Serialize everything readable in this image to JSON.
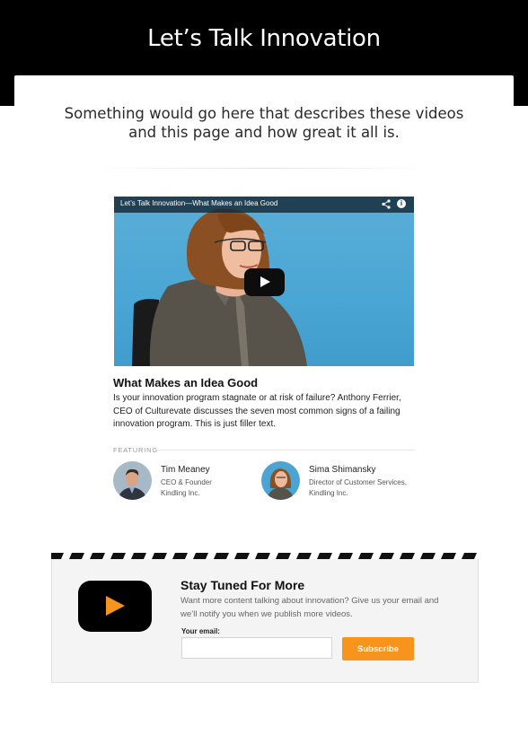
{
  "page": {
    "title": "Let’s Talk Innovation",
    "intro": "Something would go here that describes these videos and this page and how great it all is."
  },
  "video": {
    "player_title": "Let’s Talk Innovation—What Makes an Idea Good",
    "share_icon": "share-icon",
    "info_icon": "info-icon",
    "info_glyph": "i",
    "title": "What Makes an Idea Good",
    "description": "Is your innovation program stagnate or at risk of failure? Anthony Ferrier, CEO of Culturevate discusses the seven most common signs of a failing innovation program. This is just filler text."
  },
  "featuring": {
    "label": "FEATURING",
    "people": [
      {
        "name": "Tim Meaney",
        "role_line1": "CEO & Founder",
        "role_line2": "Kindling Inc."
      },
      {
        "name": "Sima Shimansky",
        "role_line1": "Director of Customer Services,",
        "role_line2": "Kindling Inc."
      }
    ]
  },
  "subscribe": {
    "title": "Stay Tuned For More",
    "description": "Want more content talking about innovation? Give us your email and we’ll notify you when we publish more videos.",
    "email_label": "Your email:",
    "email_value": "",
    "email_placeholder": "",
    "button_label": "Subscribe"
  },
  "colors": {
    "header_bg": "#000000",
    "accent": "#f7941d",
    "video_bg": "#4aa6d4"
  }
}
